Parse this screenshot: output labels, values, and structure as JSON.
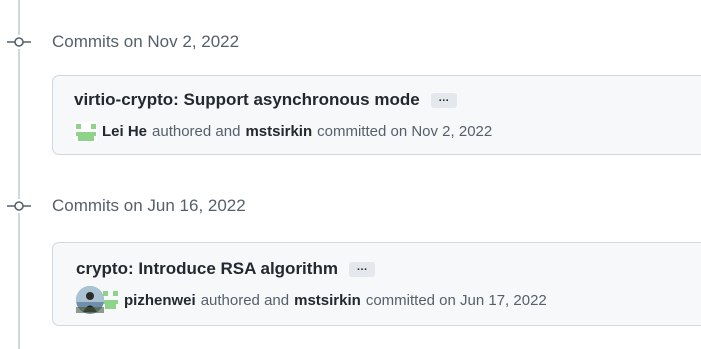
{
  "groups": [
    {
      "date_heading": "Commits on Nov 2, 2022",
      "commit": {
        "title": "virtio-crypto: Support asynchronous mode",
        "ellipsis": "…",
        "author": "Lei He",
        "authored_text": "authored and",
        "committer": "mstsirkin",
        "committed_text": "committed on Nov 2, 2022",
        "avatar_icon": "identicon-green",
        "avatar_color": "#8fd28a"
      }
    },
    {
      "date_heading": "Commits on Jun 16, 2022",
      "commit": {
        "title": "crypto: Introduce RSA algorithm",
        "ellipsis": "…",
        "author": "pizhenwei",
        "authored_text": "authored and",
        "committer": "mstsirkin",
        "committed_text": "committed on Jun 17, 2022",
        "avatar_icon": "photo-avatar-with-identicon",
        "avatar_color": "#8fd28a"
      }
    }
  ],
  "colors": {
    "timeline": "#d0d7de",
    "box_bg": "#f6f8fa",
    "box_border": "#d0d7de",
    "muted_text": "#57606a",
    "strong_text": "#24292f"
  }
}
